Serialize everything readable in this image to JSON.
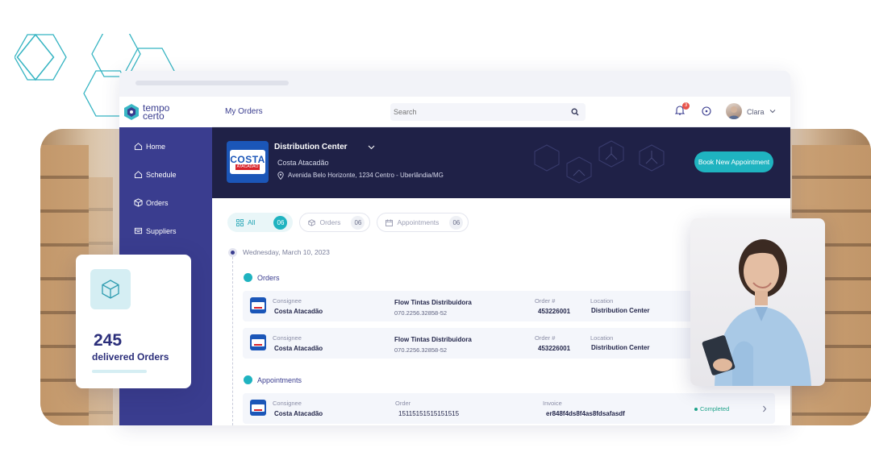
{
  "brand": {
    "line1": "tempo",
    "line2": "certo"
  },
  "sidebar": {
    "items": [
      {
        "label": "Home",
        "icon": "home-icon"
      },
      {
        "label": "Schedule",
        "icon": "schedule-icon"
      },
      {
        "label": "Orders",
        "icon": "box-icon"
      },
      {
        "label": "Suppliers",
        "icon": "suppliers-icon"
      }
    ]
  },
  "header": {
    "title": "My Orders",
    "search_placeholder": "Search",
    "notification_count": "3",
    "user_name": "Clara"
  },
  "banner": {
    "title": "Distribution Center",
    "company": "Costa Atacadão",
    "address": "Avenida Belo Horizonte, 1234 Centro - Uberlândia/MG",
    "book_button": "Book New Appointment",
    "logo_text": "COSTA",
    "logo_sub": "ATACADÃO"
  },
  "tabs": [
    {
      "label": "All",
      "count": "06",
      "active": true
    },
    {
      "label": "Orders",
      "count": "06",
      "active": false
    },
    {
      "label": "Appointments",
      "count": "06",
      "active": false
    }
  ],
  "timeline": {
    "date": "Wednesday, March 10, 2023"
  },
  "sections": {
    "orders": "Orders",
    "appointments": "Appointments"
  },
  "order_rows": [
    {
      "consignee_label": "Consignee",
      "consignee": "Costa Atacadão",
      "supplier": "Flow Tintas Distribuidora",
      "supplier_id": "070.2256.32858-52",
      "order_label": "Order #",
      "order": "453226001",
      "location_label": "Location",
      "location": "Distribution Center"
    },
    {
      "consignee_label": "Consignee",
      "consignee": "Costa Atacadão",
      "supplier": "Flow Tintas Distribuidora",
      "supplier_id": "070.2256.32858-52",
      "order_label": "Order #",
      "order": "453226001",
      "location_label": "Location",
      "location": "Distribution Center"
    }
  ],
  "appointment_rows": [
    {
      "consignee_label": "Consignee",
      "consignee": "Costa Atacadão",
      "order_label": "Order",
      "order": "15115151515151515",
      "invoice_label": "Invoice",
      "invoice": "er848f4ds8f4as8fdsafasdf",
      "status": "Completed"
    }
  ],
  "stat_card": {
    "value": "245",
    "label": "delivered Orders"
  },
  "colors": {
    "primary": "#3a3d8f",
    "banner": "#1f2147",
    "accent": "#1fb3c0",
    "success": "#1fa38a"
  }
}
